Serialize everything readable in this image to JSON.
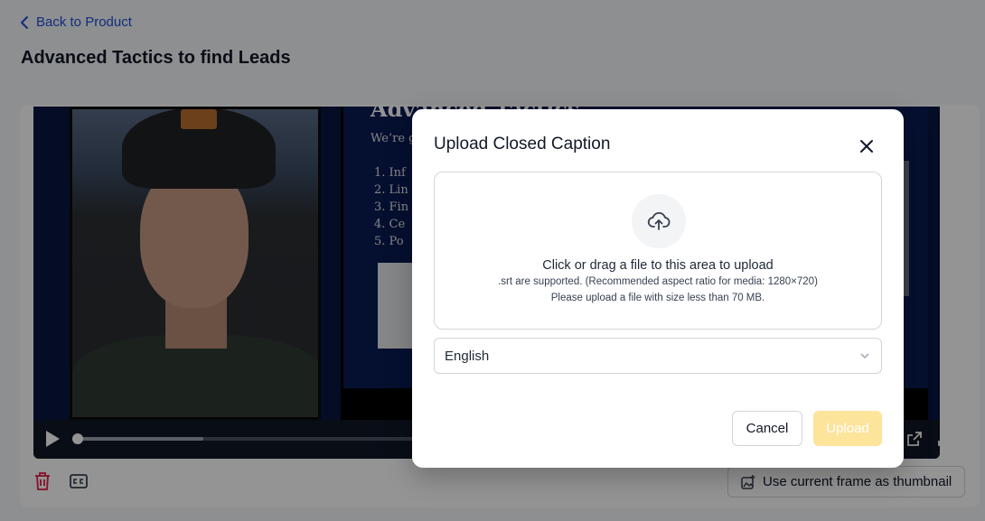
{
  "header": {
    "back_label": "Back to Product",
    "page_title": "Advanced Tactics to find Leads"
  },
  "video": {
    "slide_title": "Advanced Tactics",
    "slide_intro": "We’re g",
    "slide_items": [
      "1.   Inf",
      "2.   Lin",
      "3.   Fin",
      "4.   Ce",
      "5.   Po"
    ],
    "progress_fraction": 0.0,
    "buffered_fraction": 0.25
  },
  "toolbar": {
    "thumbnail_label": "Use current frame as thumbnail"
  },
  "modal": {
    "title": "Upload Closed Caption",
    "drop_main": "Click or drag a file to this area to upload",
    "drop_formats": ".srt are supported. (Recommended aspect ratio for media: 1280×720)",
    "drop_size": "Please upload a file with size less than 70 MB.",
    "language_value": "English",
    "cancel_label": "Cancel",
    "upload_label": "Upload"
  },
  "colors": {
    "accent_link": "#1d4ed8",
    "upload_disabled": "#fde49b",
    "delete_icon": "#e11d48"
  },
  "icons": [
    "chevron-left-icon",
    "play-icon",
    "external-link-icon",
    "fullscreen-icon",
    "trash-icon",
    "closed-caption-icon",
    "image-plus-icon",
    "close-icon",
    "upload-cloud-icon",
    "chevron-down-icon"
  ]
}
